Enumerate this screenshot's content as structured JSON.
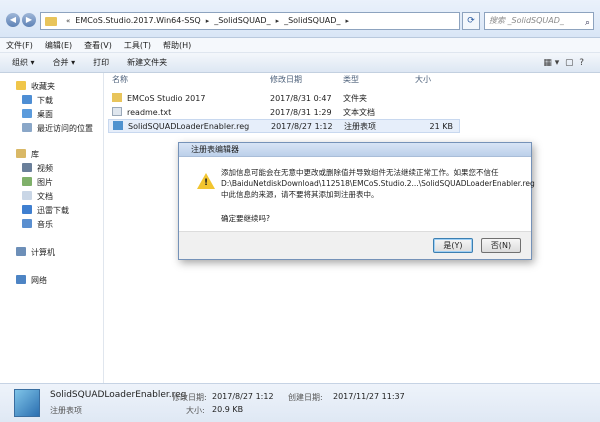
{
  "address": {
    "segments": [
      "EMCoS.Studio.2017.Win64-SSQ",
      "_SolidSQUAD_",
      "_SolidSQUAD_"
    ],
    "search_placeholder": "搜索 _SolidSQUAD_"
  },
  "menu": [
    "文件(F)",
    "编辑(E)",
    "查看(V)",
    "工具(T)",
    "帮助(H)"
  ],
  "toolbar": {
    "organize": "组织 ▾",
    "merge": "合并 ▾",
    "print": "打印",
    "new_folder": "新建文件夹"
  },
  "nav": {
    "favorites": "收藏夹",
    "fav_items": [
      "下载",
      "桌面",
      "最近访问的位置"
    ],
    "libraries": "库",
    "lib_items": [
      "视频",
      "图片",
      "文档",
      "迅雷下载",
      "音乐"
    ],
    "computer": "计算机",
    "network": "网络"
  },
  "columns": {
    "name": "名称",
    "date": "修改日期",
    "type": "类型",
    "size": "大小"
  },
  "files": [
    {
      "name": "EMCoS Studio 2017",
      "date": "2017/8/31 0:47",
      "type": "文件夹",
      "size": ""
    },
    {
      "name": "readme.txt",
      "date": "2017/8/31 1:29",
      "type": "文本文档",
      "size": ""
    },
    {
      "name": "SolidSQUADLoaderEnabler.reg",
      "date": "2017/8/27 1:12",
      "type": "注册表项",
      "size": "21 KB"
    }
  ],
  "details": {
    "name": "SolidSQUADLoaderEnabler.reg",
    "type": "注册表项",
    "modified_label": "修改日期:",
    "modified": "2017/8/27 1:12",
    "created_label": "创建日期:",
    "created": "2017/11/27 11:37",
    "size_label": "大小:",
    "size": "20.9 KB"
  },
  "dialog": {
    "title": "注册表编辑器",
    "message": "添加信息可能会在无意中更改或删除值并导致组件无法继续正常工作。如果您不信任 D:\\BaiduNetdiskDownload\\112518\\EMCoS.Studio.2...\\SolidSQUADLoaderEnabler.reg 中此信息的来源，请不要将其添加到注册表中。",
    "question": "确定要继续吗?",
    "yes": "是(Y)",
    "no": "否(N)"
  }
}
